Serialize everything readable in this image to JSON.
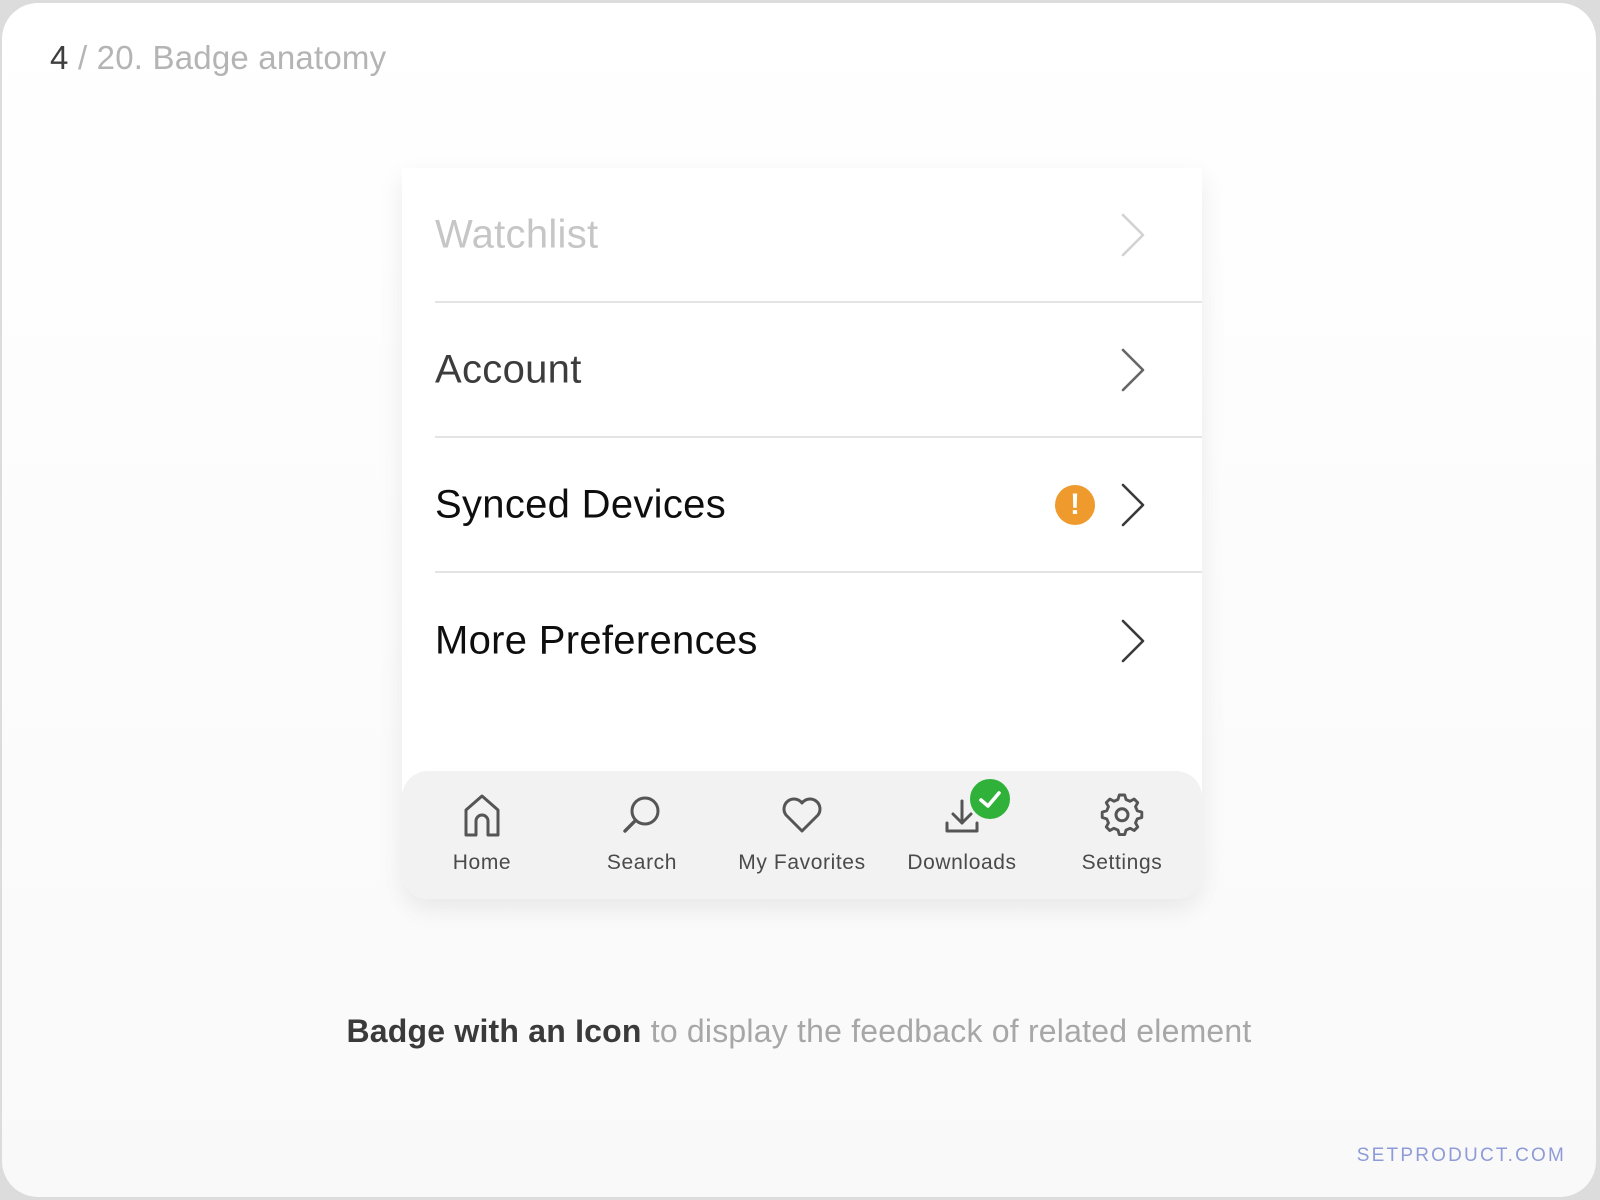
{
  "slide": {
    "number": "4",
    "title": "/ 20. Badge anatomy"
  },
  "menu": {
    "items": [
      {
        "label": "Watchlist"
      },
      {
        "label": "Account"
      },
      {
        "label": "Synced Devices",
        "badge": "!"
      },
      {
        "label": "More Preferences"
      }
    ]
  },
  "tabbar": {
    "tabs": [
      {
        "label": "Home",
        "icon": "home-icon"
      },
      {
        "label": "Search",
        "icon": "search-icon"
      },
      {
        "label": "My Favorites",
        "icon": "heart-icon"
      },
      {
        "label": "Downloads",
        "icon": "download-icon",
        "badge_icon": "check-icon"
      },
      {
        "label": "Settings",
        "icon": "gear-icon"
      }
    ]
  },
  "caption": {
    "emphasis": "Badge with an Icon",
    "rest": " to display the feedback of related element"
  },
  "brand": "SETPRODUCT.COM",
  "colors": {
    "alert_badge": "#ef9a2c",
    "success_badge": "#2fb13a",
    "brand": "#8e9bd8"
  }
}
